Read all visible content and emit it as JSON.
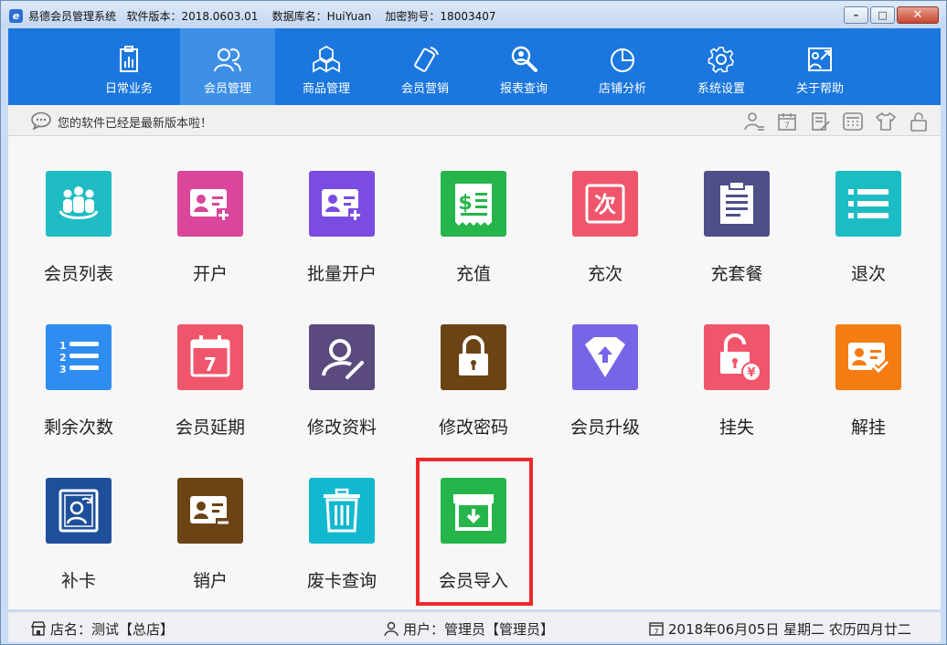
{
  "window": {
    "title": "易德会员管理系统   软件版本：2018.0603.01    数据库名：HuiYuan    加密狗号：18003407",
    "app_icon_glyph": "e"
  },
  "nav": {
    "items": [
      {
        "label": "日常业务",
        "icon": "clipboard-chart-icon"
      },
      {
        "label": "会员管理",
        "icon": "members-icon"
      },
      {
        "label": "商品管理",
        "icon": "boxes-icon"
      },
      {
        "label": "会员营销",
        "icon": "phone-tag-icon"
      },
      {
        "label": "报表查询",
        "icon": "magnifier-person-icon"
      },
      {
        "label": "店铺分析",
        "icon": "pie-chart-icon"
      },
      {
        "label": "系统设置",
        "icon": "gear-icon"
      },
      {
        "label": "关于帮助",
        "icon": "help-board-icon"
      }
    ],
    "active_index": 1
  },
  "notice": {
    "text": "您的软件已经是最新版本啦！"
  },
  "tiles": [
    {
      "label": "会员列表",
      "color": "#1fbcc4",
      "icon": "member-group-icon"
    },
    {
      "label": "开户",
      "color": "#d9469a",
      "icon": "id-card-add-icon"
    },
    {
      "label": "批量开户",
      "color": "#7a4de0",
      "icon": "id-card-add-icon"
    },
    {
      "label": "充值",
      "color": "#25b54a",
      "icon": "receipt-dollar-icon"
    },
    {
      "label": "充次",
      "color": "#f0566b",
      "icon": "times-char-icon",
      "glyph": "次"
    },
    {
      "label": "充套餐",
      "color": "#4e4f86",
      "icon": "package-doc-icon"
    },
    {
      "label": "退次",
      "color": "#1cbcc4",
      "icon": "list-icon"
    },
    {
      "label": "剩余次数",
      "color": "#2f8cf0",
      "icon": "numbered-list-icon"
    },
    {
      "label": "会员延期",
      "color": "#f0566b",
      "icon": "calendar-icon",
      "glyph": "7"
    },
    {
      "label": "修改资料",
      "color": "#5a4a7e",
      "icon": "user-edit-icon"
    },
    {
      "label": "修改密码",
      "color": "#6b4314",
      "icon": "lock-icon"
    },
    {
      "label": "会员升级",
      "color": "#7665e6",
      "icon": "diamond-up-icon"
    },
    {
      "label": "挂失",
      "color": "#f0566b",
      "icon": "lock-yen-icon",
      "glyph": "¥"
    },
    {
      "label": "解挂",
      "color": "#f57c12",
      "icon": "id-card-check-icon"
    },
    {
      "label": "补卡",
      "color": "#1e4f9a",
      "icon": "portrait-refresh-icon"
    },
    {
      "label": "销户",
      "color": "#6b4314",
      "icon": "id-card-remove-icon"
    },
    {
      "label": "废卡查询",
      "color": "#12b8d0",
      "icon": "trash-icon"
    },
    {
      "label": "会员导入",
      "color": "#25b54a",
      "icon": "inbox-import-icon"
    }
  ],
  "status": {
    "store": "店名：测试【总店】",
    "user": "用户：管理员【管理员】",
    "date": "2018年06月05日 星期二 农历四月廿二",
    "calendar_glyph": "7"
  }
}
